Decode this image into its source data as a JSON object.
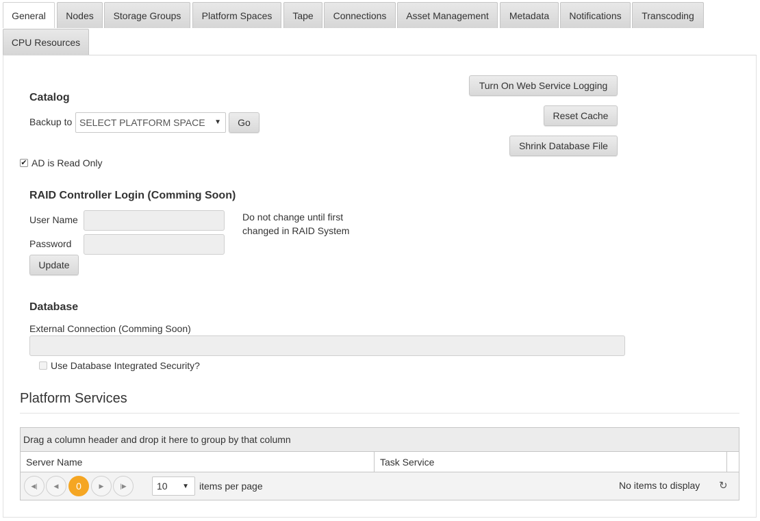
{
  "tabs": [
    {
      "label": "General",
      "active": true
    },
    {
      "label": "Nodes"
    },
    {
      "label": "Storage Groups"
    },
    {
      "label": "Platform Spaces"
    },
    {
      "label": "Tape"
    },
    {
      "label": "Connections"
    },
    {
      "label": "Asset Management"
    },
    {
      "label": "Metadata"
    },
    {
      "label": "Notifications"
    },
    {
      "label": "Transcoding"
    },
    {
      "label": "CPU Resources"
    }
  ],
  "actions": {
    "web_service_logging": "Turn On Web Service Logging",
    "reset_cache": "Reset Cache",
    "shrink_database": "Shrink Database File"
  },
  "catalog": {
    "title": "Catalog",
    "backup_label": "Backup to",
    "select_value": "SELECT PLATFORM SPACE",
    "go_label": "Go"
  },
  "ad_read_only": {
    "label": "AD is Read Only",
    "checked": true
  },
  "raid": {
    "title": "RAID Controller Login (Comming Soon)",
    "username_label": "User Name",
    "password_label": "Password",
    "note": "Do not change until first changed in RAID System",
    "update_label": "Update"
  },
  "database": {
    "title": "Database",
    "external_label": "External Connection (Comming Soon)",
    "integrated_security_label": "Use Database Integrated Security?",
    "integrated_security_checked": false
  },
  "platform_services": {
    "title": "Platform Services",
    "group_hint": "Drag a column header and drop it here to group by that column",
    "columns": [
      "Server Name",
      "Task Service"
    ],
    "page_current": "0",
    "page_size": "10",
    "items_per_page": "items per page",
    "empty_text": "No items to display"
  },
  "colors": {
    "accent": "#f5a623"
  },
  "icons": [
    "first-page-icon",
    "prev-page-icon",
    "next-page-icon",
    "last-page-icon",
    "refresh-icon",
    "dropdown-caret-icon",
    "checkmark-icon"
  ]
}
